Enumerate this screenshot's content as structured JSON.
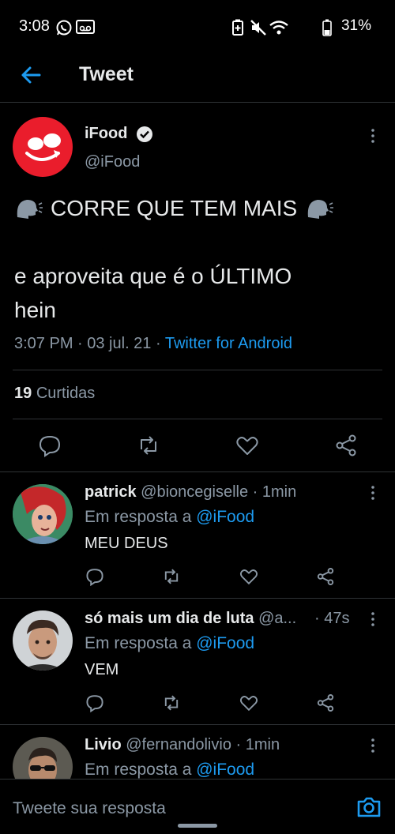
{
  "status_bar": {
    "time": "3:08",
    "battery": "31%"
  },
  "header": {
    "title": "Tweet"
  },
  "tweet": {
    "author_name": "iFood",
    "author_handle": "@iFood",
    "line1": "CORRE QUE TEM MAIS",
    "line2": "e aproveita que é o ÚLTIMO",
    "line3": "hein",
    "time": "3:07 PM · 03 jul. 21 · ",
    "client": "Twitter for Android",
    "likes_count": "19",
    "likes_label": "Curtidas",
    "brand_color": "#ea1d2c"
  },
  "replies": [
    {
      "name": "patrick",
      "handle": "@bioncegiselle",
      "age": "· 1min",
      "reply_prefix": "Em resposta a ",
      "reply_to": "@iFood",
      "text": "MEU DEUS"
    },
    {
      "name": "só mais um dia de luta",
      "handle": "@a...",
      "age": "· 47s",
      "reply_prefix": "Em resposta a ",
      "reply_to": "@iFood",
      "text": "VEM"
    },
    {
      "name": "Livio",
      "handle": "@fernandolivio",
      "age": "· 1min",
      "reply_prefix": "Em resposta a ",
      "reply_to": "@iFood",
      "text": ""
    }
  ],
  "composer": {
    "placeholder": "Tweete sua resposta"
  },
  "colors": {
    "accent": "#1d9bf0",
    "background": "#000000",
    "muted": "#8b98a5"
  }
}
